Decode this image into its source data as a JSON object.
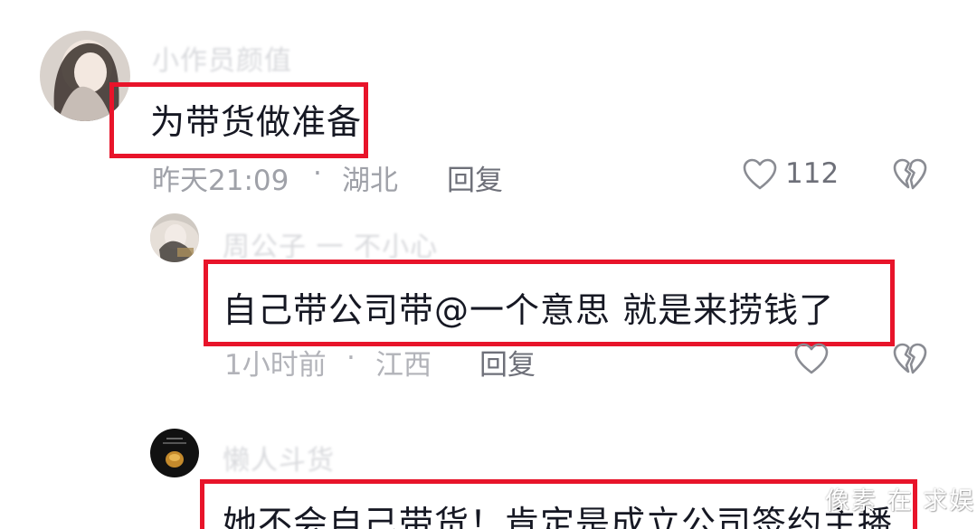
{
  "comments": [
    {
      "username": "小作员颜值",
      "content": "为带货做准备",
      "time": "昨天21:09",
      "separator": "·",
      "location": "湖北",
      "reply_label": "回复",
      "like_count": "112"
    },
    {
      "username": "周公子 一 不小心",
      "content": "自己带公司带@一个意思 就是来捞钱了",
      "time": "1小时前",
      "separator": "·",
      "location": "江西",
      "reply_label": "回复",
      "like_count": ""
    },
    {
      "username": "懒人斗货",
      "content": "她不会自己带货！肯定是成立公司签约主播"
    }
  ],
  "icons": {
    "like": "heart-outline-icon",
    "dislike": "broken-heart-icon"
  },
  "watermark": "像素 在 求娱",
  "colors": {
    "highlight": "#e8142a",
    "meta_text": "#9fa1a8",
    "body_text": "#161823"
  }
}
